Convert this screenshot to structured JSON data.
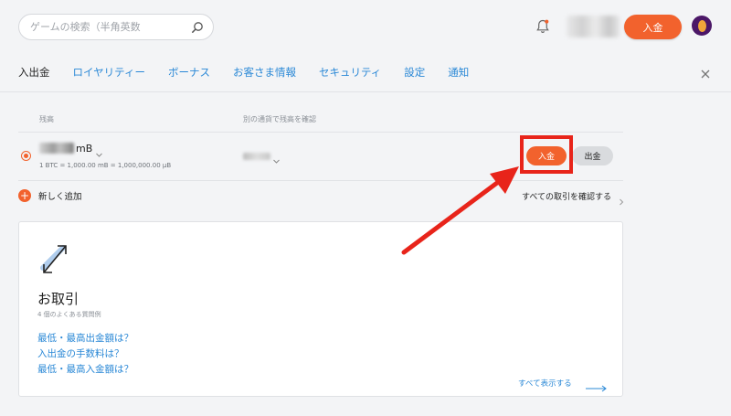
{
  "header": {
    "search_placeholder": "ゲームの検索（半角英数",
    "deposit_button": "入金",
    "colors": {
      "accent": "#f2622d",
      "avatar_bg": "#4b1767"
    }
  },
  "tabs": [
    {
      "label": "入出金",
      "active": true
    },
    {
      "label": "ロイヤリティー"
    },
    {
      "label": "ボーナス"
    },
    {
      "label": "お客さま情報"
    },
    {
      "label": "セキュリティ"
    },
    {
      "label": "設定"
    },
    {
      "label": "通知"
    }
  ],
  "wallet": {
    "col_balance": "残高",
    "col_other_currency": "別の通貨で残高を確認",
    "unit": "mB",
    "conversion": "1 BTC = 1,000.00 mB = 1,000,000.00 μB",
    "deposit_label": "入金",
    "withdraw_label": "出金",
    "add_new": "新しく追加",
    "view_all_transactions": "すべての取引を確認する"
  },
  "card": {
    "title": "お取引",
    "subtitle": "4 個のよくある質問例",
    "faqs": [
      "最低・最高出金額は？",
      "入出金の手数料は？",
      "最低・最高入金額は？"
    ],
    "show_all": "すべて表示する"
  },
  "annotation": {
    "color": "#e8241a"
  }
}
